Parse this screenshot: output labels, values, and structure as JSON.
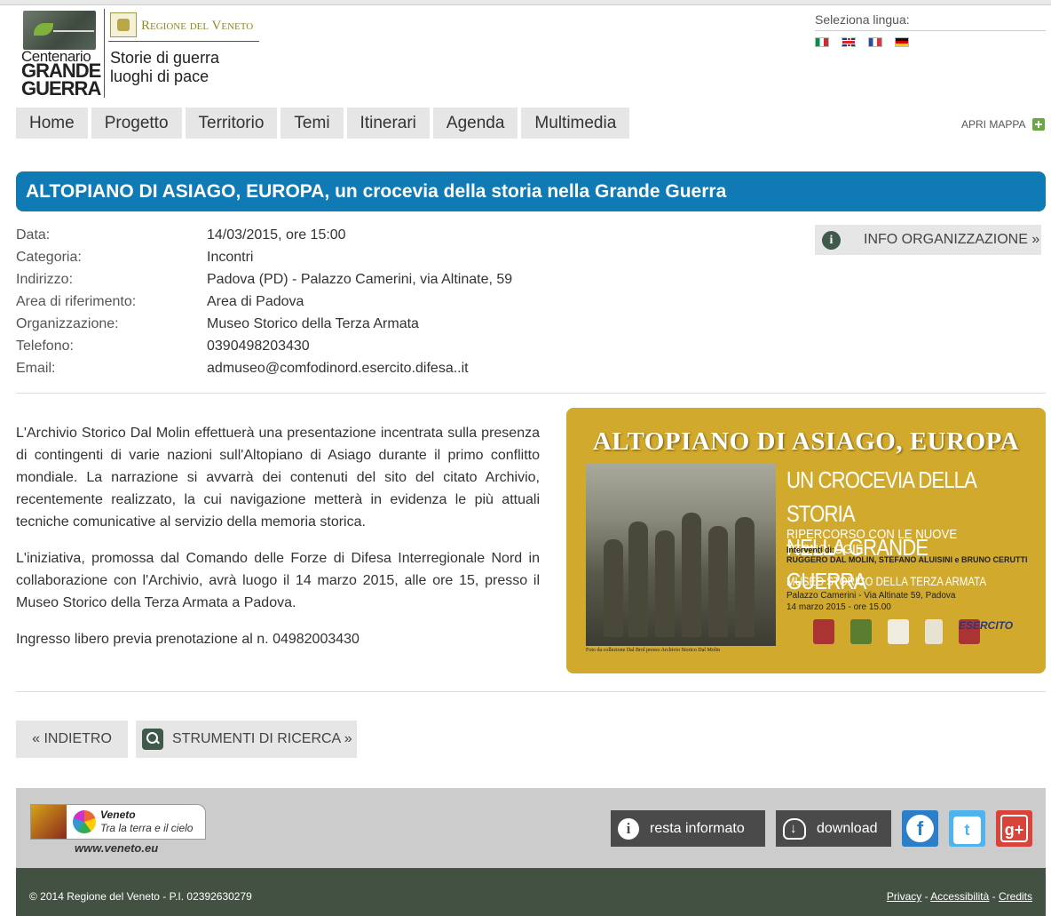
{
  "header": {
    "logo_line1": "Centenario",
    "logo_line2": "GRANDE",
    "logo_line3": "GUERRA",
    "regione": "Regione del Veneto",
    "tagline1": "Storie di guerra",
    "tagline2": "luoghi di pace",
    "lang_label": "Seleziona lingua:",
    "flags": [
      "flag-it-icon",
      "flag-en-icon",
      "flag-fr-icon",
      "flag-de-icon"
    ]
  },
  "nav": {
    "items": [
      "Home",
      "Progetto",
      "Territorio",
      "Temi",
      "Itinerari",
      "Agenda",
      "Multimedia"
    ],
    "apri_mappa": "APRI MAPPA"
  },
  "event": {
    "title": "ALTOPIANO DI ASIAGO, EUROPA, un crocevia della storia nella Grande Guerra",
    "info_button": "INFO ORGANIZZAZIONE »",
    "details": [
      {
        "k": "Data:",
        "v": "14/03/2015,  ore  15:00"
      },
      {
        "k": "Categoria:",
        "v": "Incontri"
      },
      {
        "k": "Indirizzo:",
        "v": "Padova (PD) - Palazzo Camerini, via Altinate, 59"
      },
      {
        "k": "Area di riferimento:",
        "v": "Area di Padova"
      },
      {
        "k": "Organizzazione:",
        "v": "Museo Storico della Terza Armata"
      },
      {
        "k": "Telefono:",
        "v": "0390498203430"
      },
      {
        "k": "Email:",
        "v": "admuseo@comfodinord.esercito.difesa..it"
      }
    ],
    "paragraphs": [
      "L'Archivio Storico Dal Molin effettuerà una presentazione incentrata sulla presenza di contingenti di varie nazioni sull'Altopiano di Asiago durante il primo conflitto mondiale. La narrazione si avvarrà dei contenuti del sito del citato Archivio, recentemente realizzato, la cui navigazione metterà in evidenza le più attuali tecniche comunicative al servizio della memoria storica.",
      "L'iniziativa, promossa dal Comando delle Forze di Difesa Interregionale Nord in collaborazione con l'Archivio, avrà luogo il 14 marzo 2015, alle ore 15, presso il Museo Storico della Terza Armata a Padova.",
      "Ingresso libero previa prenotazione al n. 04982003430"
    ]
  },
  "poster": {
    "title": "ALTOPIANO DI ASIAGO, EUROPA",
    "sub1": "UN CROCEVIA DELLA STORIA",
    "sub2": "NELLA GRANDE GUERRA",
    "sub3": "RIPERCORSO CON LE NUOVE TECNOLOGIE",
    "interventi": "Interventi di:",
    "speakers": "RUGGERO DAL MOLIN, STEFANO ALUISINI e BRUNO CERUTTI",
    "museo": "MUSEO STORICO DELLA TERZA ARMATA",
    "address": "Palazzo Camerini - Via Altinate 59, Padova",
    "date": "14 marzo 2015 - ore 15.00",
    "caption": "Foto da collezione Dal Brol presso Archivio Storico Dal Molin",
    "esercito": "ESERCITO"
  },
  "actions": {
    "back": "« INDIETRO",
    "search": "STRUMENTI DI RICERCA »"
  },
  "footer": {
    "veneto_name": "Veneto",
    "veneto_slogan": "Tra la terra e il cielo",
    "veneto_url": "www.veneto.eu",
    "resta": "resta informato",
    "download": "download",
    "copyright": "© 2014 Regione del Veneto - P.I. 02392630279",
    "privacy": "Privacy",
    "accessibilita": "Accessibilità",
    "credits": "Credits",
    "sep": " - "
  }
}
